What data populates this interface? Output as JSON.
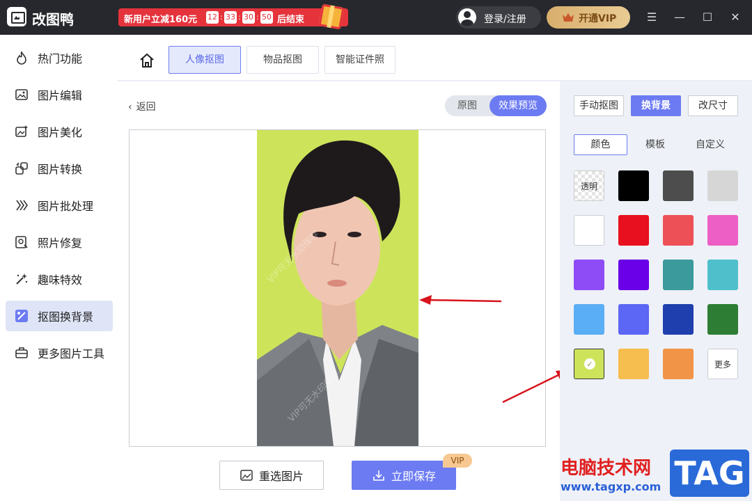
{
  "app": {
    "name": "改图鸭",
    "promo_text": "新用户立减160元",
    "timer": [
      "12",
      "33",
      "30",
      "50"
    ],
    "promo_end": "后结束",
    "login_label": "登录/注册",
    "vip_label": "开通VIP"
  },
  "sidebar": {
    "items": [
      {
        "label": "热门功能",
        "icon": "flame-icon"
      },
      {
        "label": "图片编辑",
        "icon": "image-edit-icon"
      },
      {
        "label": "图片美化",
        "icon": "image-beautify-icon"
      },
      {
        "label": "图片转换",
        "icon": "image-convert-icon"
      },
      {
        "label": "图片批处理",
        "icon": "batch-icon"
      },
      {
        "label": "照片修复",
        "icon": "photo-repair-icon"
      },
      {
        "label": "趣味特效",
        "icon": "magic-wand-icon"
      },
      {
        "label": "抠图换背景",
        "icon": "cutout-icon",
        "active": true
      },
      {
        "label": "更多图片工具",
        "icon": "toolbox-icon"
      }
    ]
  },
  "tabs": [
    {
      "label": "人像抠图",
      "active": true
    },
    {
      "label": "物品抠图"
    },
    {
      "label": "智能证件照"
    }
  ],
  "main": {
    "back_label": "返回",
    "toggle_original": "原图",
    "toggle_preview": "效果预览",
    "reselect_label": "重选图片",
    "save_label": "立即保存",
    "vip_badge": "VIP",
    "watermark_text": "VIP可无水印保存"
  },
  "panel": {
    "modes": [
      {
        "label": "手动抠图"
      },
      {
        "label": "换背景",
        "active": true
      },
      {
        "label": "改尺寸"
      }
    ],
    "subtabs": [
      {
        "label": "颜色",
        "active": true
      },
      {
        "label": "模板"
      },
      {
        "label": "自定义"
      }
    ],
    "swatches": [
      {
        "label": "透明",
        "color": "transparent"
      },
      {
        "color": "#000000"
      },
      {
        "color": "#4d4d4d"
      },
      {
        "color": "#d6d6d6"
      },
      {
        "color": "#ffffff"
      },
      {
        "color": "#e8101e"
      },
      {
        "color": "#ee5058"
      },
      {
        "color": "#ee5fc5"
      },
      {
        "color": "#8d4cf5"
      },
      {
        "color": "#6a00e8"
      },
      {
        "color": "#3b9a9c"
      },
      {
        "color": "#4fc0cb"
      },
      {
        "color": "#5aaef5"
      },
      {
        "color": "#5d67f5"
      },
      {
        "color": "#1f3fae"
      },
      {
        "color": "#2e7d34"
      },
      {
        "color": "#cde45a",
        "selected": true
      },
      {
        "color": "#f6bd4f"
      },
      {
        "color": "#f29447"
      },
      {
        "label": "更多",
        "color": "#ffffff"
      }
    ]
  },
  "site_watermark": {
    "title": "电脑技术网",
    "url": "www.tagxp.com",
    "tag": "TAG"
  }
}
